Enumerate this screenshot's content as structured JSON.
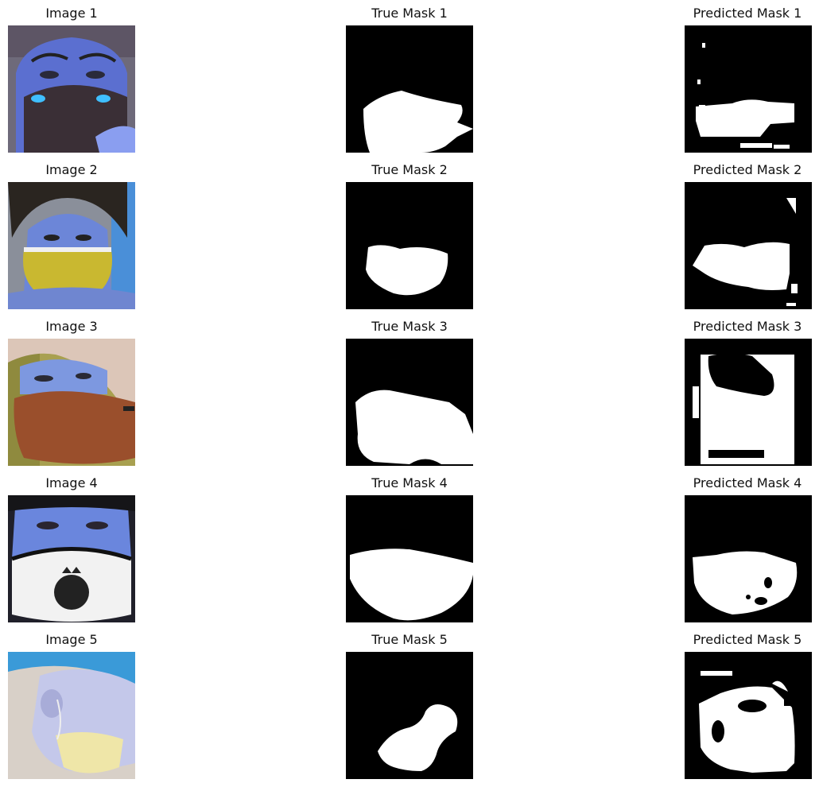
{
  "rows": [
    {
      "image_title": "Image 1",
      "true_title": "True Mask 1",
      "pred_title": "Predicted Mask 1"
    },
    {
      "image_title": "Image 2",
      "true_title": "True Mask 2",
      "pred_title": "Predicted Mask 2"
    },
    {
      "image_title": "Image 3",
      "true_title": "True Mask 3",
      "pred_title": "Predicted Mask 3"
    },
    {
      "image_title": "Image 4",
      "true_title": "True Mask 4",
      "pred_title": "Predicted Mask 4"
    },
    {
      "image_title": "Image 5",
      "true_title": "True Mask 5",
      "pred_title": "Predicted Mask 5"
    }
  ],
  "colors": {
    "mask_background": "#000000",
    "mask_foreground": "#ffffff",
    "face_tint": "#6f8ee8"
  }
}
